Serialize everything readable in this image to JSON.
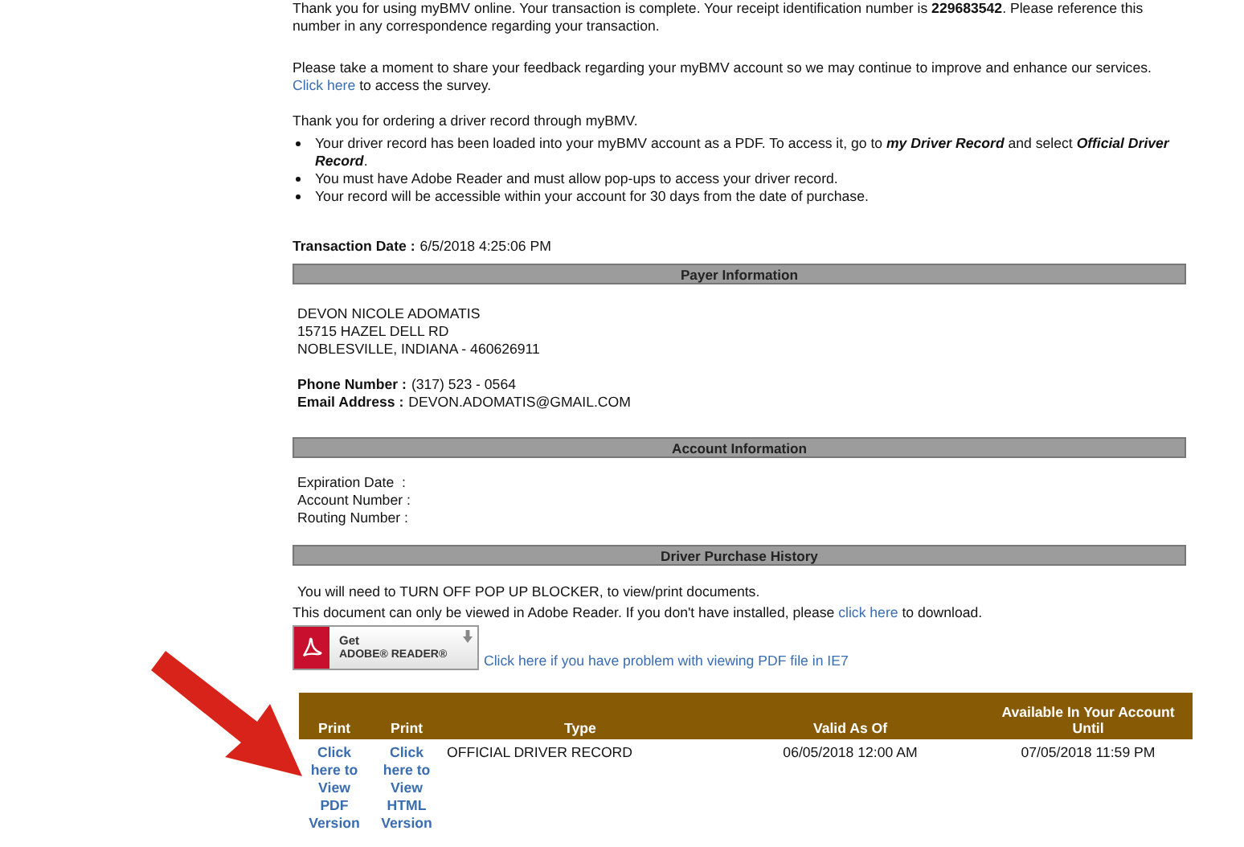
{
  "intro": {
    "receipt": "Thank you for using myBMV online. Your transaction is complete. Your receipt identification number is **229683542**. Please reference this number in any correspondence regarding your transaction.",
    "feedback": {
      "before": "Please take a moment to share your feedback regarding your myBMV account so we may continue to improve and enhance our services.",
      "link": "Click here",
      "after": "to access the survey."
    },
    "thanks": "Thank you for ordering a driver record through myBMV.",
    "bullets": [
      "Your driver record has been loaded into your myBMV account as a PDF. To access it, go to **my Driver Record** and select **Official Driver Record**.",
      "You must have Adobe Reader and must allow pop-ups to access your driver record.",
      "Your record will be accessible within your account for 30 days from the date of purchase."
    ]
  },
  "transaction_date": {
    "label": "Transaction Date :",
    "value": "6/5/2018 4:25:06 PM"
  },
  "payer": {
    "title": "Payer Information",
    "address": [
      "DEVON NICOLE ADOMATIS",
      "15715 HAZEL DELL RD",
      "NOBLESVILLE, INDIANA - 460626911"
    ],
    "fields": [
      {
        "label": "Phone Number :",
        "value": "(317) 523 - 0564"
      },
      {
        "label": "Email Address :",
        "value": "DEVON.ADOMATIS@GMAIL.COM"
      }
    ]
  },
  "account": {
    "title": "Account Information",
    "fields": [
      "Expiration Date  :",
      "Account Number :",
      "Routing Number :"
    ]
  },
  "history": {
    "title": "Driver Purchase History",
    "notice": "You will need to TURN OFF POP UP BLOCKER, to view/print documents.",
    "reader_note": {
      "before": "This document can only be viewed in Adobe Reader. If you don't have installed, please",
      "link": "click here",
      "after": "to download."
    },
    "adobe_button": {
      "line_1": "Get",
      "line_2": "ADOBE® READER®"
    },
    "ie7_link": "Click here if you have problem with viewing PDF file in IE7",
    "table": {
      "columns": [
        "Print",
        "Print",
        "Type",
        "Valid As Of",
        "Available In Your Account Until"
      ],
      "rows": [
        {
          "pdf_link": "Click here to View PDF Version",
          "html_link": "Click here to View HTML Version",
          "type": "OFFICIAL DRIVER RECORD",
          "valid_as_of": "06/05/2018 12:00 AM",
          "available_until": "07/05/2018 11:59 PM"
        }
      ]
    }
  }
}
